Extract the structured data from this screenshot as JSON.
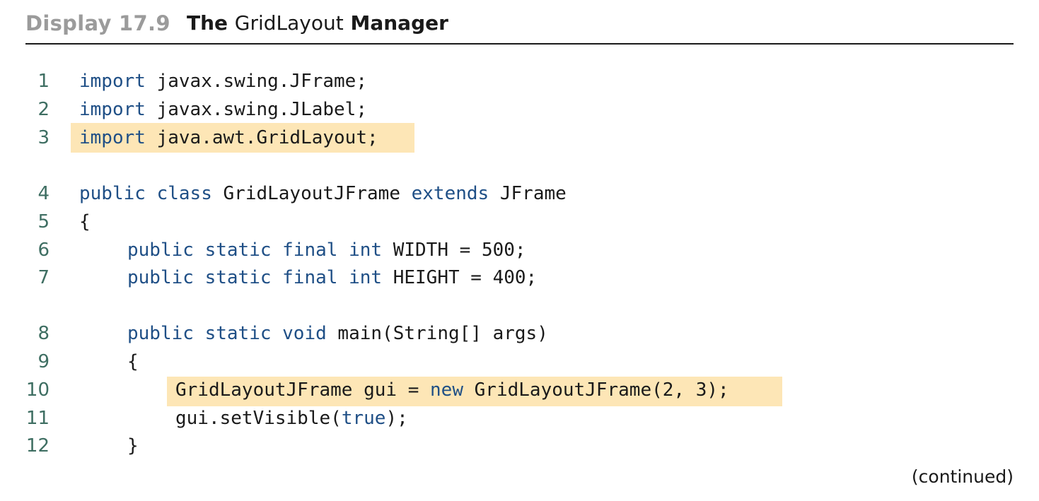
{
  "header": {
    "display_label": "Display 17.9",
    "title_prefix": "The ",
    "title_code": "GridLayout",
    "title_suffix": " Manager"
  },
  "colors": {
    "keyword": "#1f4f86",
    "line_number": "#3e6e62",
    "highlight": "#fde6b6",
    "display_label": "#9b9b9b"
  },
  "lines": [
    {
      "n": "1",
      "tokens": [
        [
          "kw",
          "import"
        ],
        [
          "t",
          " javax.swing.JFrame;"
        ]
      ]
    },
    {
      "n": "2",
      "tokens": [
        [
          "kw",
          "import"
        ],
        [
          "t",
          " javax.swing.JLabel;"
        ]
      ]
    },
    {
      "n": "3",
      "tokens": [
        [
          "kw",
          "import"
        ],
        [
          "t",
          " java.awt.GridLayout;"
        ]
      ]
    },
    {
      "n": "4",
      "tokens": [
        [
          "kw",
          "public"
        ],
        [
          "t",
          " "
        ],
        [
          "kw",
          "class"
        ],
        [
          "t",
          " GridLayoutJFrame "
        ],
        [
          "kw",
          "extends"
        ],
        [
          "t",
          " JFrame"
        ]
      ]
    },
    {
      "n": "5",
      "tokens": [
        [
          "t",
          "{"
        ]
      ]
    },
    {
      "n": "6",
      "tokens": [
        [
          "kw",
          "public"
        ],
        [
          "t",
          " "
        ],
        [
          "kw",
          "static"
        ],
        [
          "t",
          " "
        ],
        [
          "kw",
          "final"
        ],
        [
          "t",
          " "
        ],
        [
          "kw",
          "int"
        ],
        [
          "t",
          " WIDTH = 500;"
        ]
      ]
    },
    {
      "n": "7",
      "tokens": [
        [
          "kw",
          "public"
        ],
        [
          "t",
          " "
        ],
        [
          "kw",
          "static"
        ],
        [
          "t",
          " "
        ],
        [
          "kw",
          "final"
        ],
        [
          "t",
          " "
        ],
        [
          "kw",
          "int"
        ],
        [
          "t",
          " HEIGHT = 400;"
        ]
      ]
    },
    {
      "n": "8",
      "tokens": [
        [
          "kw",
          "public"
        ],
        [
          "t",
          " "
        ],
        [
          "kw",
          "static"
        ],
        [
          "t",
          " "
        ],
        [
          "kw",
          "void"
        ],
        [
          "t",
          " main(String[] args)"
        ]
      ]
    },
    {
      "n": "9",
      "tokens": [
        [
          "t",
          "{"
        ]
      ]
    },
    {
      "n": "10",
      "tokens": [
        [
          "t",
          "GridLayoutJFrame gui = "
        ],
        [
          "kw",
          "new"
        ],
        [
          "t",
          " GridLayoutJFrame(2, 3);"
        ]
      ]
    },
    {
      "n": "11",
      "tokens": [
        [
          "t",
          "gui.setVisible("
        ],
        [
          "kw",
          "true"
        ],
        [
          "t",
          ");"
        ]
      ]
    },
    {
      "n": "12",
      "tokens": [
        [
          "t",
          "}"
        ]
      ]
    }
  ],
  "footer": {
    "continued": "(continued)"
  }
}
